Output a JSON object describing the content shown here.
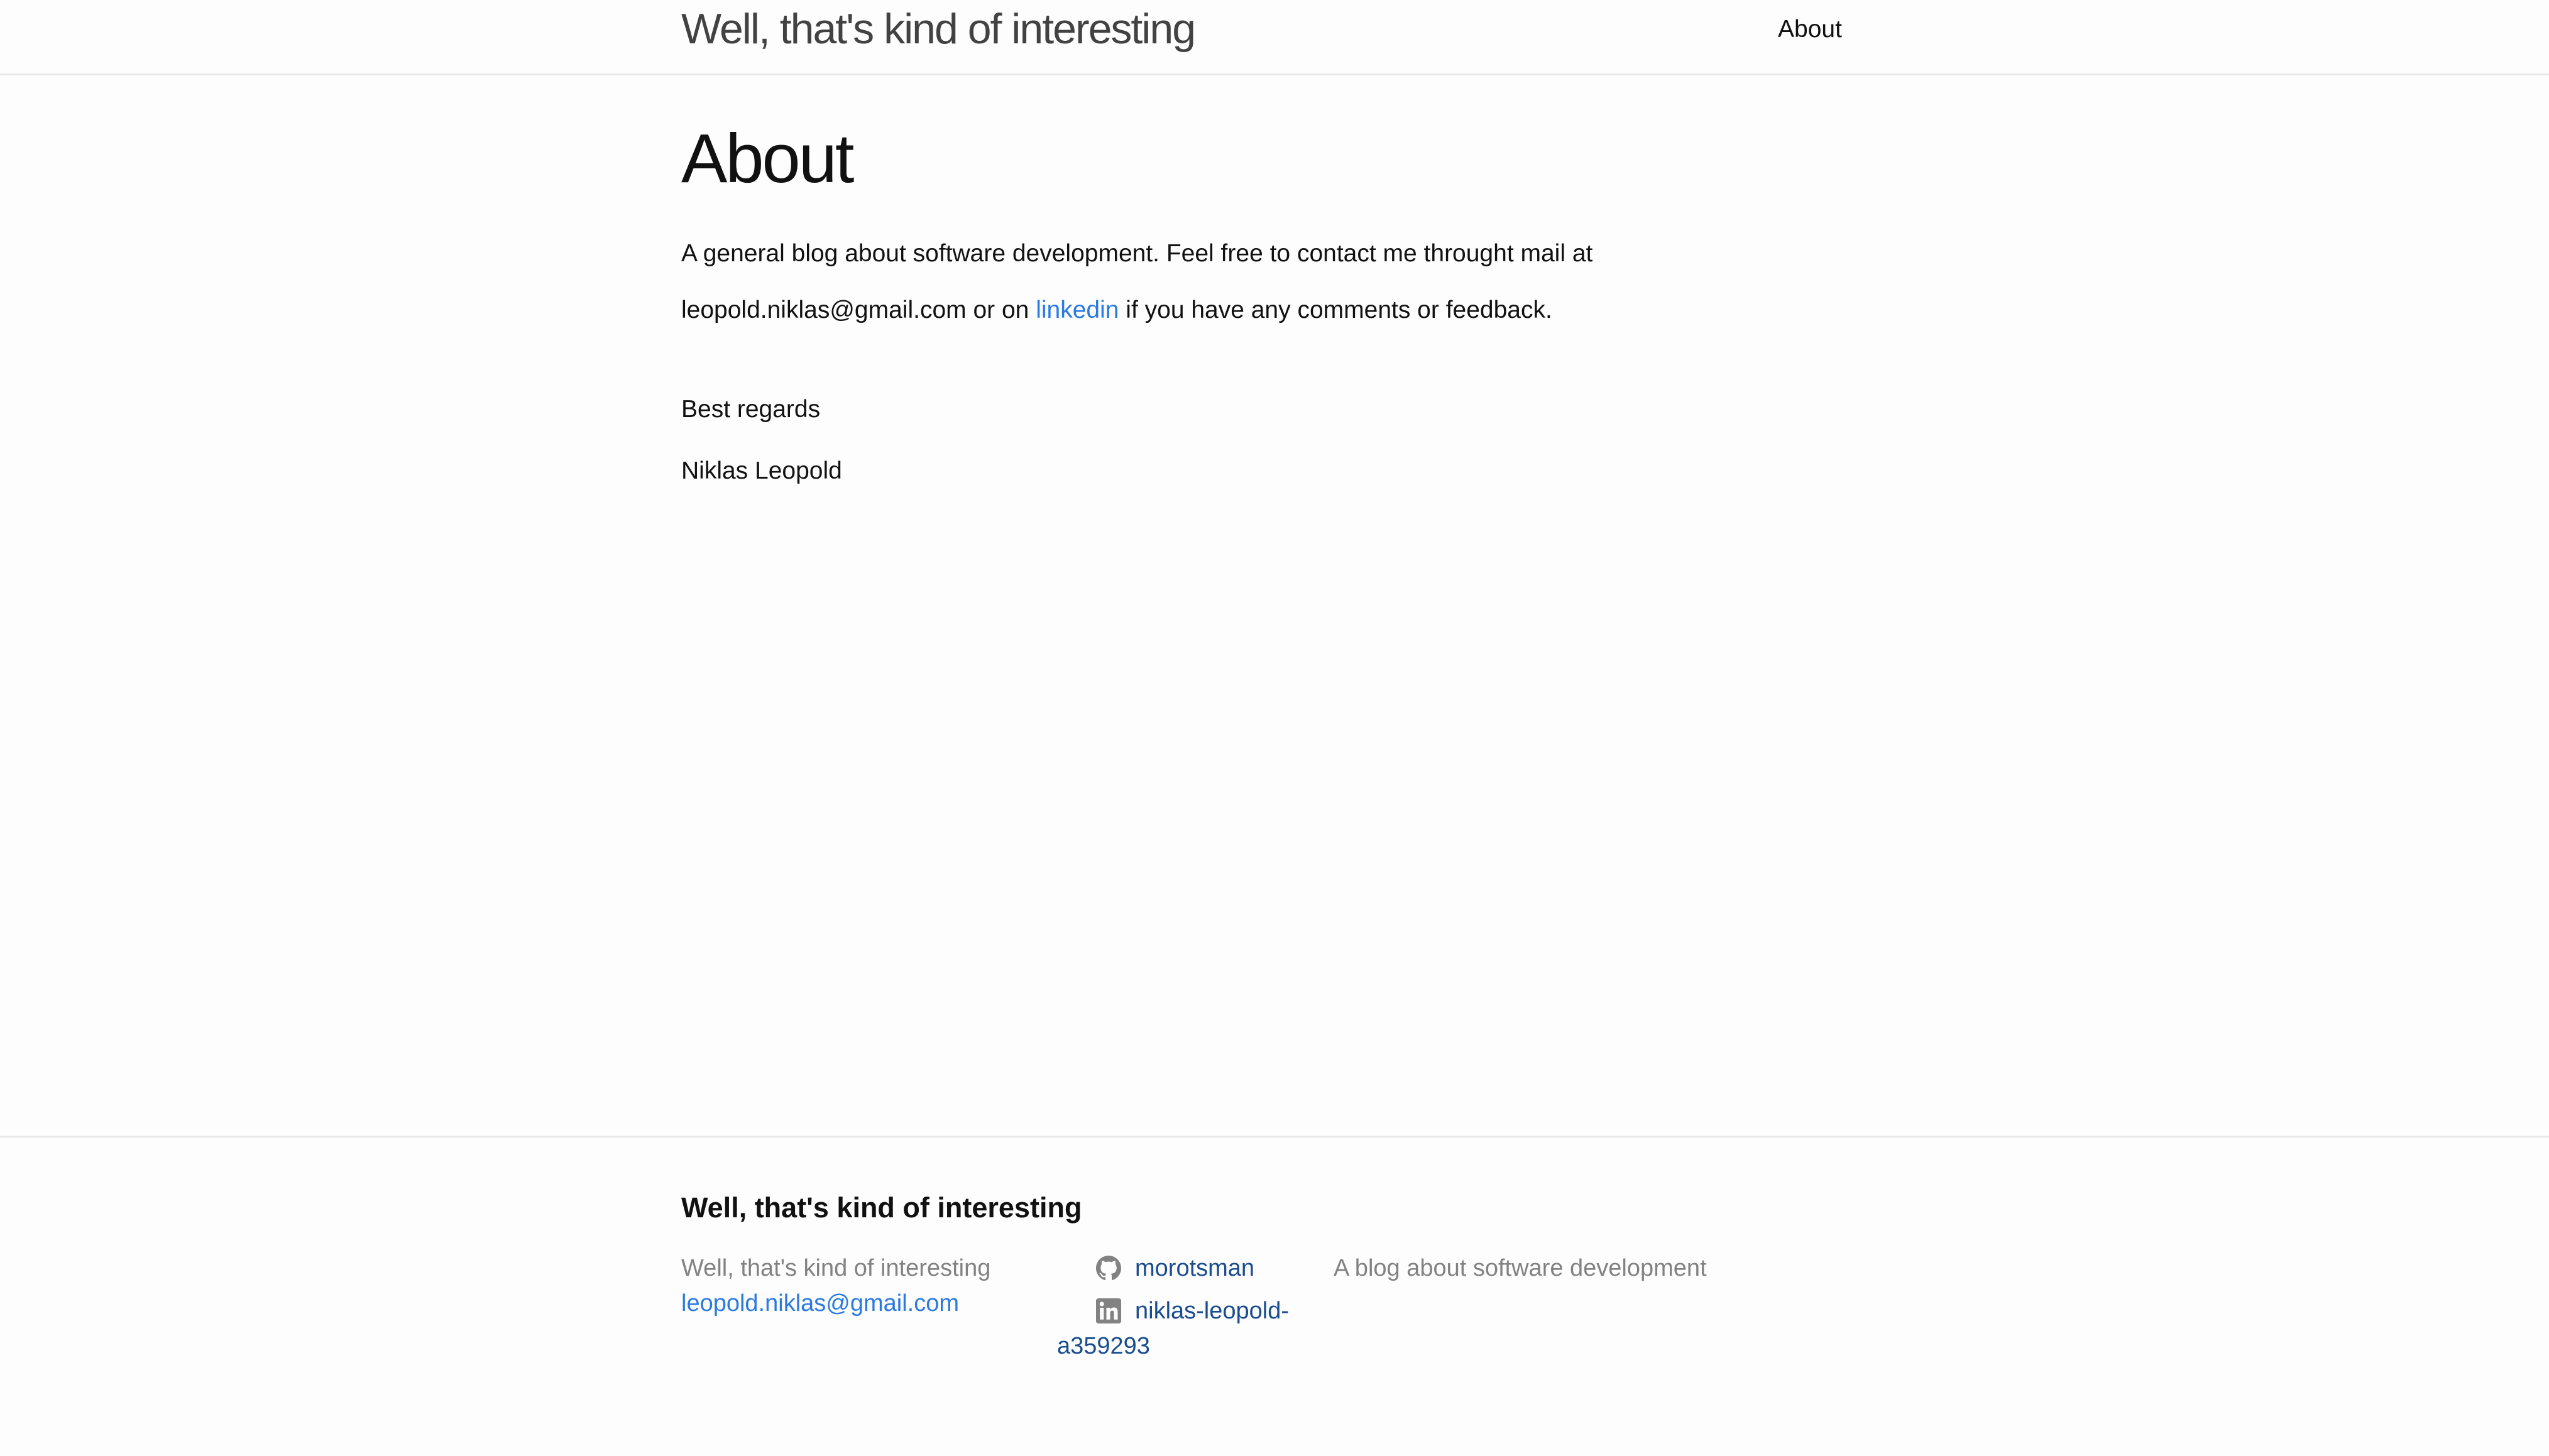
{
  "header": {
    "site_title": "Well, that's kind of interesting",
    "nav": [
      {
        "label": "About"
      }
    ]
  },
  "main": {
    "title": "About",
    "paragraph1_line1": "A general blog about software development. Feel free to contact me throught mail at",
    "paragraph1_line2_prefix": "leopold.niklas@gmail.com or on ",
    "paragraph1_link": "linkedin",
    "paragraph1_line2_suffix": " if you have any comments or feedback.",
    "paragraph2": "Best regards",
    "paragraph3": "Niklas Leopold"
  },
  "footer": {
    "heading": "Well, that's kind of interesting",
    "col1_name": "Well, that's kind of interesting",
    "col1_email": "leopold.niklas@gmail.com",
    "github_username": "morotsman",
    "linkedin_username": "niklas-leopold-a359293",
    "description": "A blog about software development"
  },
  "colors": {
    "link": "#2a7ae2",
    "text": "#111111",
    "muted": "#828282",
    "border": "#e8e8e8"
  },
  "icons": [
    "github-icon",
    "linkedin-icon"
  ]
}
